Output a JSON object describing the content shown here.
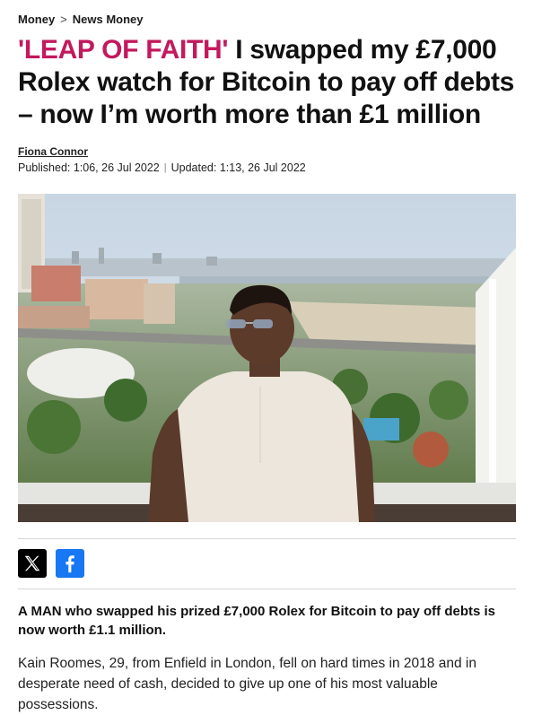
{
  "breadcrumb": {
    "section": "Money",
    "separator": ">",
    "subsection": "News Money"
  },
  "headline": {
    "kicker": "'LEAP OF FAITH'",
    "title": " I swapped my £7,000 Rolex watch for Bitcoin to pay off debts – now I’m worth more than £1 million"
  },
  "byline": {
    "author": "Fiona Connor",
    "published": "Published: 1:06, 26 Jul 2022",
    "divider": "|",
    "updated": "Updated: 1:13, 26 Jul 2022"
  },
  "hero": {
    "description_icon": "photo"
  },
  "share": {
    "x_icon": "x-logo-icon",
    "facebook_icon": "facebook-logo-icon"
  },
  "article": {
    "lede": "A MAN who swapped his prized £7,000 Rolex for Bitcoin to pay off debts is now worth £1.1 million.",
    "paragraph_1": "Kain Roomes, 29, from Enfield in London, fell on hard times in 2018 and in desperate need of cash, decided to give up one of his most valuable possessions."
  },
  "colors": {
    "kicker": "#c3195d",
    "facebook": "#1877f2",
    "x": "#000000"
  }
}
